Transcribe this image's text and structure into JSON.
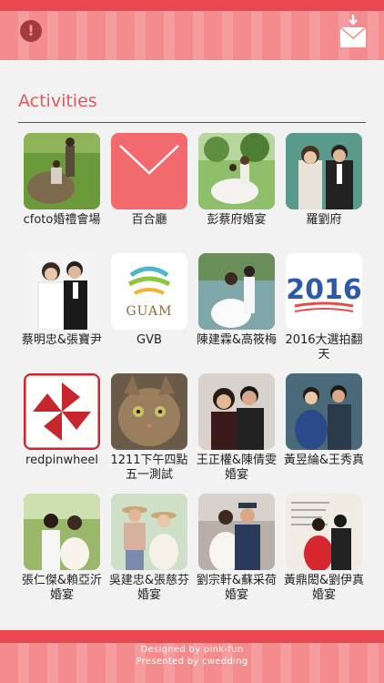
{
  "header": {
    "alert_icon": "exclamation-circle-icon",
    "mail_icon": "mail-download-icon",
    "colors": {
      "primary": "#e8474f",
      "stripe_a": "#f48b8d",
      "stripe_b": "#f79c9e",
      "title": "#e0595e"
    }
  },
  "section": {
    "title": "Activities"
  },
  "activities": [
    {
      "label": "cfoto婚禮會場",
      "thumb": "photo-couple-grass"
    },
    {
      "label": "百合廳",
      "thumb": "mail-envelope-icon"
    },
    {
      "label": "彭蔡府婚宴",
      "thumb": "photo-couple-garden"
    },
    {
      "label": "羅劉府",
      "thumb": "photo-couple-portrait"
    },
    {
      "label": "蔡明忠&張寶尹",
      "thumb": "photo-couple-white"
    },
    {
      "label": "GVB",
      "thumb": "guam-logo"
    },
    {
      "label": "陳建霖&高筱梅",
      "thumb": "photo-couple-lake"
    },
    {
      "label": "2016大選拍翻天",
      "thumb": "2016-logo"
    },
    {
      "label": "redpinwheel",
      "thumb": "pinwheel-logo"
    },
    {
      "label": "1211下午四點五一測試",
      "thumb": "photo-cat"
    },
    {
      "label": "王正權&陳倩雯婚宴",
      "thumb": "photo-couple-dark"
    },
    {
      "label": "黃昱綸&王秀真",
      "thumb": "photo-couple-blue"
    },
    {
      "label": "張仁傑&賴亞沂婚宴",
      "thumb": "photo-couple-outdoor"
    },
    {
      "label": "吳建忠&張慈芬婚宴",
      "thumb": "photo-couple-hats"
    },
    {
      "label": "劉宗軒&蘇采荷婚宴",
      "thumb": "photo-couple-military"
    },
    {
      "label": "黃鼎閎&劉伊真婚宴",
      "thumb": "photo-couple-red-dress"
    }
  ],
  "logos": {
    "guam_text": "GUAM",
    "year_text": "2016"
  },
  "footer": {
    "line1": "Designed by pink-fun",
    "line2": "Presented by cwedding"
  }
}
